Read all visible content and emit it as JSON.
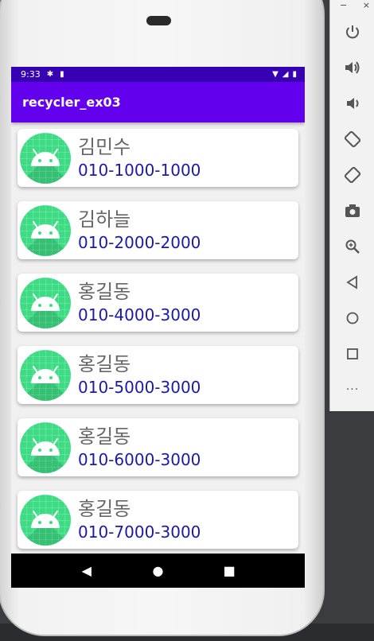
{
  "status_bar": {
    "time": "9:33"
  },
  "app_bar": {
    "title": "recycler_ex03"
  },
  "contacts": [
    {
      "name": "김민수",
      "phone": "010-1000-1000"
    },
    {
      "name": "김하늘",
      "phone": "010-2000-2000"
    },
    {
      "name": "홍길동",
      "phone": "010-4000-3000"
    },
    {
      "name": "홍길동",
      "phone": "010-5000-3000"
    },
    {
      "name": "홍길동",
      "phone": "010-6000-3000"
    },
    {
      "name": "홍길동",
      "phone": "010-7000-3000"
    }
  ],
  "nav_bar": {
    "back": "◀",
    "home": "●",
    "recents": "■"
  },
  "emulator_toolbar": {
    "minimize": "−",
    "close": "×",
    "buttons": [
      "power-icon",
      "volume-up-icon",
      "volume-down-icon",
      "rotate-left-icon",
      "rotate-right-icon",
      "camera-icon",
      "zoom-icon",
      "back-icon",
      "home-icon",
      "overview-icon",
      "more-icon"
    ],
    "more_label": "···"
  },
  "colors": {
    "status_bar": "#3700b3",
    "app_bar": "#6200ee",
    "avatar": "#3ddc84",
    "phone_text": "#1a1aa6"
  }
}
